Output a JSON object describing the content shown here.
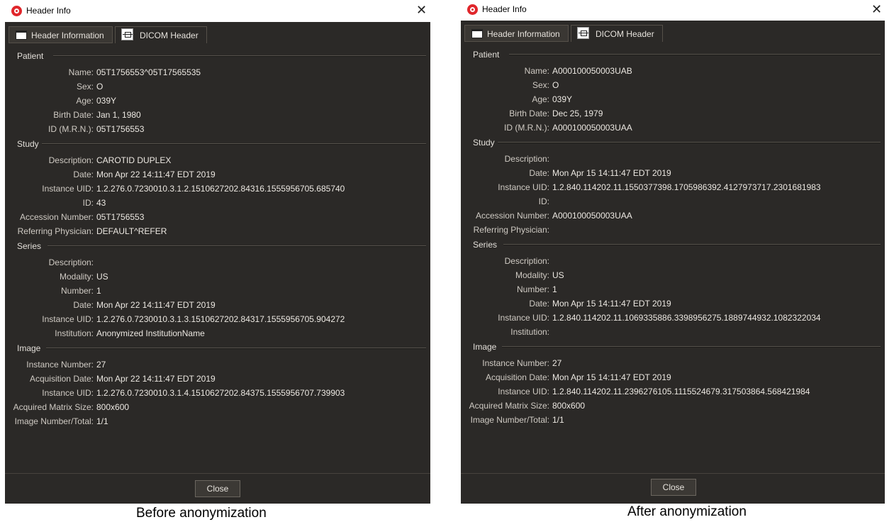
{
  "window_title": "Header Info",
  "close_symbol": "✕",
  "tabs": {
    "header_info": "Header Information",
    "dicom_header": "DICOM Header"
  },
  "sections": {
    "patient": "Patient",
    "study": "Study",
    "series": "Series",
    "image": "Image"
  },
  "labels": {
    "name": "Name:",
    "sex": "Sex:",
    "age": "Age:",
    "birth_date": "Birth Date:",
    "id_mrn": "ID (M.R.N.):",
    "description": "Description:",
    "date": "Date:",
    "instance_uid": "Instance UID:",
    "id": "ID:",
    "accession_number": "Accession Number:",
    "referring_physician": "Referring Physician:",
    "modality": "Modality:",
    "number": "Number:",
    "institution": "Institution:",
    "instance_number": "Instance Number:",
    "acquisition_date": "Acquisition Date:",
    "acquired_matrix_size": "Acquired Matrix Size:",
    "image_number_total": "Image Number/Total:"
  },
  "close_button": "Close",
  "before": {
    "caption": "Before anonymization",
    "patient": {
      "name": "05T1756553^05T17565535",
      "sex": "O",
      "age": "039Y",
      "birth_date": "Jan 1, 1980",
      "id_mrn": "05T1756553"
    },
    "study": {
      "description": "CAROTID DUPLEX",
      "date": "Mon Apr 22 14:11:47 EDT 2019",
      "instance_uid": "1.2.276.0.7230010.3.1.2.1510627202.84316.1555956705.685740",
      "id": "43",
      "accession_number": "05T1756553",
      "referring_physician": "DEFAULT^REFER"
    },
    "series": {
      "description": "",
      "modality": "US",
      "number": "1",
      "date": "Mon Apr 22 14:11:47 EDT 2019",
      "instance_uid": "1.2.276.0.7230010.3.1.3.1510627202.84317.1555956705.904272",
      "institution": "Anonymized InstitutionName"
    },
    "image": {
      "instance_number": "27",
      "acquisition_date": "Mon Apr 22 14:11:47 EDT 2019",
      "instance_uid": "1.2.276.0.7230010.3.1.4.1510627202.84375.1555956707.739903",
      "acquired_matrix_size": "800x600",
      "image_number_total": "1/1"
    }
  },
  "after": {
    "caption": "After anonymization",
    "patient": {
      "name": "A000100050003UAB",
      "sex": "O",
      "age": "039Y",
      "birth_date": "Dec 25, 1979",
      "id_mrn": "A000100050003UAA"
    },
    "study": {
      "description": "",
      "date": "Mon Apr 15 14:11:47 EDT 2019",
      "instance_uid": "1.2.840.114202.11.1550377398.1705986392.4127973717.2301681983",
      "id": "",
      "accession_number": "A000100050003UAA",
      "referring_physician": ""
    },
    "series": {
      "description": "",
      "modality": "US",
      "number": "1",
      "date": "Mon Apr 15 14:11:47 EDT 2019",
      "instance_uid": "1.2.840.114202.11.1069335886.3398956275.1889744932.1082322034",
      "institution": ""
    },
    "image": {
      "instance_number": "27",
      "acquisition_date": "Mon Apr 15 14:11:47 EDT 2019",
      "instance_uid": "1.2.840.114202.11.2396276105.1115524679.317503864.568421984",
      "acquired_matrix_size": "800x600",
      "image_number_total": "1/1"
    }
  }
}
